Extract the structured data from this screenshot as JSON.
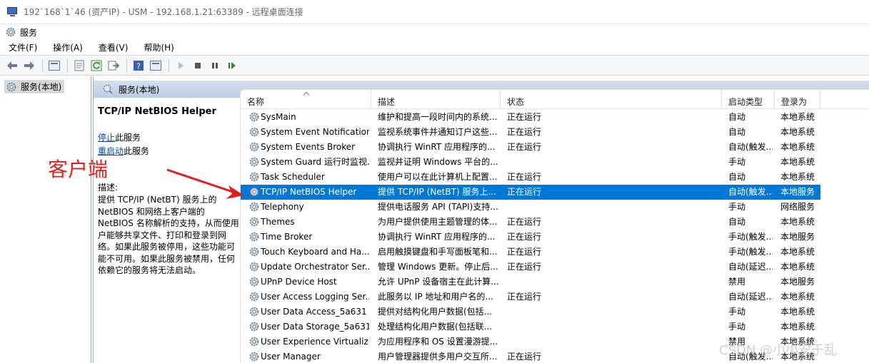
{
  "window": {
    "title": "192`168`1`46 (资产IP) - USM - 192.168.1.21:63389 - 远程桌面连接"
  },
  "app": {
    "title": "服务"
  },
  "menu": [
    "文件(F)",
    "操作(A)",
    "查看(V)",
    "帮助(H)"
  ],
  "tree": {
    "root": "服务(本地)"
  },
  "panel": {
    "header": "服务(本地)"
  },
  "details": {
    "service_name": "TCP/IP NetBIOS Helper",
    "stop_link": "停止",
    "stop_suffix": "此服务",
    "restart_link": "重启动",
    "restart_suffix": "此服务",
    "desc_label": "描述:",
    "desc_text": "提供 TCP/IP (NetBT) 服务上的 NetBIOS 和网络上客户端的 NetBIOS 名称解析的支持，从而使用户能够共享文件、打印和登录到网络。如果此服务被停用，这些功能可能不可用。如果此服务被禁用，任何依赖它的服务将无法启动。"
  },
  "columns": {
    "name": "名称",
    "description": "描述",
    "status": "状态",
    "startup": "启动类型",
    "logon": "登录为"
  },
  "services": [
    {
      "name": "SysMain",
      "description": "维护和提高一段时间内的系统...",
      "status": "正在运行",
      "startup": "自动",
      "logon": "本地系统"
    },
    {
      "name": "System Event Notification...",
      "description": "监视系统事件并通知订户这些...",
      "status": "正在运行",
      "startup": "自动",
      "logon": "本地系统"
    },
    {
      "name": "System Events Broker",
      "description": "协调执行 WinRT 应用程序的...",
      "status": "正在运行",
      "startup": "自动(触发...",
      "logon": "本地系统"
    },
    {
      "name": "System Guard 运行时监视...",
      "description": "监视并证明 Windows 平台的...",
      "status": "",
      "startup": "手动",
      "logon": "本地系统"
    },
    {
      "name": "Task Scheduler",
      "description": "使用户可以在此计算机上配置...",
      "status": "正在运行",
      "startup": "自动",
      "logon": "本地系统"
    },
    {
      "name": "TCP/IP NetBIOS Helper",
      "description": "提供 TCP/IP (NetBT) 服务上...",
      "status": "正在运行",
      "startup": "自动(触发...",
      "logon": "本地服务"
    },
    {
      "name": "Telephony",
      "description": "提供电话服务 API (TAPI)支持...",
      "status": "",
      "startup": "手动",
      "logon": "网络服务"
    },
    {
      "name": "Themes",
      "description": "为用户提供使用主题管理的体...",
      "status": "正在运行",
      "startup": "自动",
      "logon": "本地系统"
    },
    {
      "name": "Time Broker",
      "description": "协调执行 WinRT 应用程序的...",
      "status": "正在运行",
      "startup": "手动(触发...",
      "logon": "本地服务"
    },
    {
      "name": "Touch Keyboard and Ha...",
      "description": "启用触摸键盘和手写面板笔和...",
      "status": "正在运行",
      "startup": "手动(触发...",
      "logon": "本地系统"
    },
    {
      "name": "Update Orchestrator Ser...",
      "description": "管理 Windows 更新。停止后...",
      "status": "正在运行",
      "startup": "自动(延迟...",
      "logon": "本地系统"
    },
    {
      "name": "UPnP Device Host",
      "description": "允许 UPnP 设备宿主在此计算...",
      "status": "",
      "startup": "禁用",
      "logon": "本地服务"
    },
    {
      "name": "User Access Logging Ser...",
      "description": "此服务以 IP 地址和用户名的...",
      "status": "正在运行",
      "startup": "自动(延迟...",
      "logon": "本地系统"
    },
    {
      "name": "User Data Access_5a631",
      "description": "提供对结构化用户数据(包括...",
      "status": "",
      "startup": "手动",
      "logon": "本地系统"
    },
    {
      "name": "User Data Storage_5a631",
      "description": "处理结构化用户数据(包括联...",
      "status": "",
      "startup": "手动",
      "logon": "本地系统"
    },
    {
      "name": "User Experience Virtualiz...",
      "description": "为应用程序和 OS 设置漫游提...",
      "status": "",
      "startup": "禁用",
      "logon": "本地系统"
    },
    {
      "name": "User Manager",
      "description": "用户管理器提供多用户交互所...",
      "status": "正在运行",
      "startup": "自动(触发...",
      "logon": "本地系统"
    }
  ],
  "selected_index": 5,
  "annotation": {
    "label": "客户端",
    "color": "#e0201c"
  },
  "watermark": "CSDN @小小安于乱",
  "colors": {
    "selection": "#0078d7",
    "link": "#0645ad",
    "header_gradient_top": "#d5dfee",
    "header_gradient_bottom": "#bccde4"
  }
}
